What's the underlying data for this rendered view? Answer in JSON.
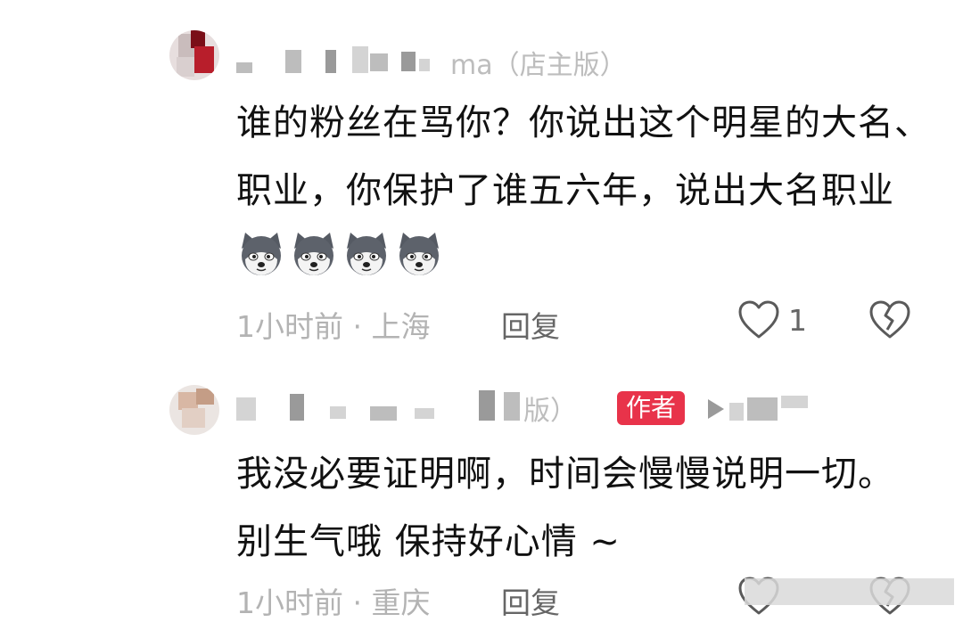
{
  "comments": [
    {
      "username_visible": "ma（店主版）",
      "text": "谁的粉丝在骂你？你说出这个明星的大名、职业，你保护了谁五六年，说出大名职业",
      "emojis": [
        "husky-emoji",
        "husky-emoji",
        "husky-emoji",
        "husky-emoji"
      ],
      "time": "1小时前",
      "location": "上海",
      "separator": "·",
      "reply_label": "回复",
      "like_count": "1"
    },
    {
      "username_visible": "版）",
      "badge": "作者",
      "text": "我没必要证明啊，时间会慢慢说明一切。 别生气哦 保持好心情 ~",
      "time": "1小时前",
      "location": "重庆",
      "separator": "·",
      "reply_label": "回复"
    }
  ],
  "icons": {
    "like": "heart-outline-icon",
    "dislike": "broken-heart-icon",
    "play": "play-triangle-icon"
  },
  "colors": {
    "badge": "#e8334a",
    "meta_text": "#b3b3b3",
    "action_text": "#666666"
  }
}
